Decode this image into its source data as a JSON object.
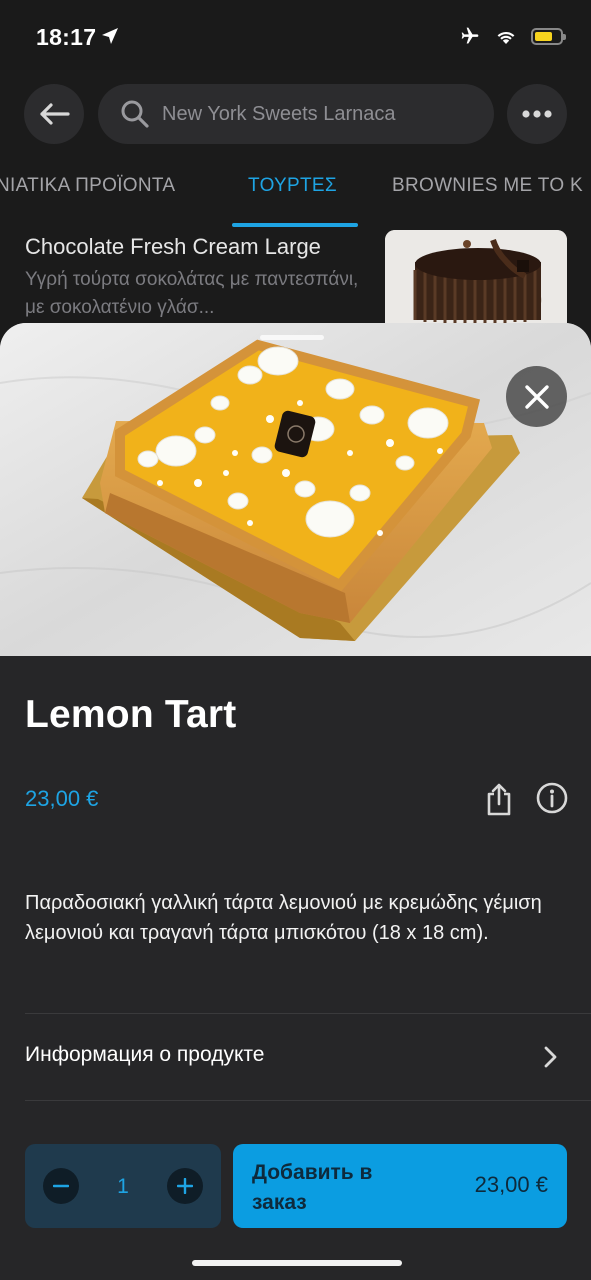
{
  "status_bar": {
    "time": "18:17",
    "battery_level": 0.72,
    "battery_color": "#f6d31e"
  },
  "nav": {
    "search_text": "New York Sweets Larnaca"
  },
  "tabs": [
    {
      "label": "ΝΙΑΤΙΚΑ ΠΡΟΪΟΝΤΑ",
      "active": false
    },
    {
      "label": "ΤΟΥΡΤΕΣ",
      "active": true
    },
    {
      "label": "BROWNIES ΜΕ ΤΟ Κ",
      "active": false
    }
  ],
  "background_item": {
    "title": "Chocolate Fresh Cream Large",
    "description": "Υγρή τούρτα σοκολάτας με παντεσπάνι, με σοκολατένιο γλάσ..."
  },
  "product": {
    "title": "Lemon Tart",
    "price": "23,00 €",
    "description": "Παραδοσιακή γαλλική τάρτα λεμονιού με κρεμώδης γέμιση λεμονιού και τραγανή τάρτα μπισκότου (18 x 18 cm).",
    "info_label": "Информация о продукте"
  },
  "order": {
    "quantity": "1",
    "add_label": "Добавить в заказ",
    "add_price": "23,00 €"
  },
  "colors": {
    "accent": "#1ea4e4",
    "button": "#0b9de1",
    "sheet": "#262628"
  }
}
